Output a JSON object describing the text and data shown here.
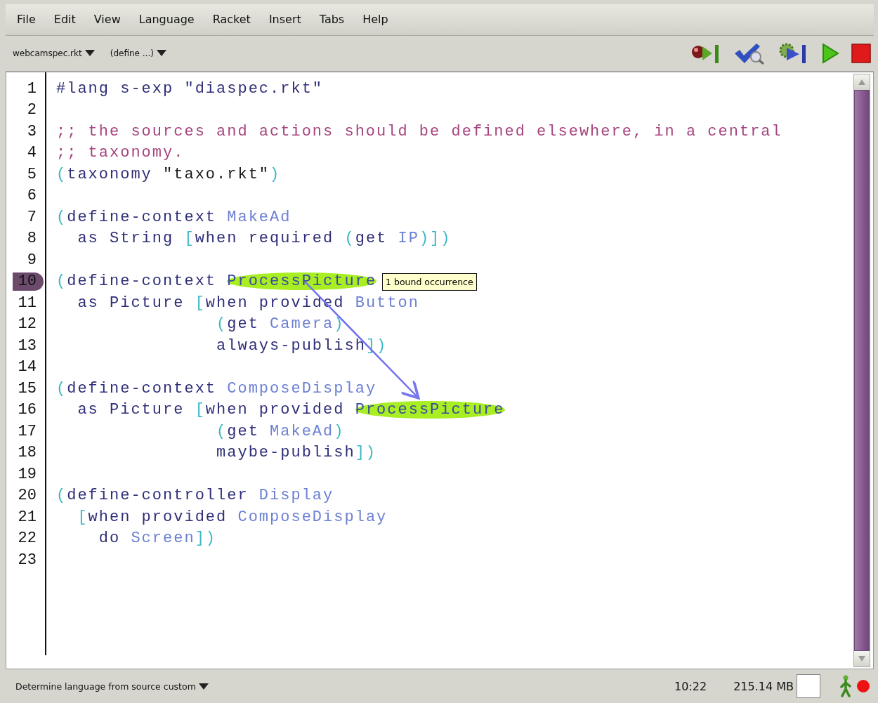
{
  "menu": [
    "File",
    "Edit",
    "View",
    "Language",
    "Racket",
    "Insert",
    "Tabs",
    "Help"
  ],
  "toolbar": {
    "file_menu": "webcamspec.rkt",
    "define_menu": "(define ...)"
  },
  "editor": {
    "lines": [
      {
        "number": "1",
        "marked": false,
        "tokens": [
          {
            "text": "#lang s-exp \"diaspec.rkt\"",
            "kind": "plain",
            "highlighted": false
          }
        ]
      },
      {
        "number": "2",
        "marked": false
      },
      {
        "number": "3",
        "marked": false,
        "tokens": [
          {
            "text": ";; the sources and actions should be defined elsewhere, in a central",
            "kind": "comment",
            "highlighted": false
          }
        ]
      },
      {
        "number": "4",
        "marked": false,
        "tokens": [
          {
            "text": ";; taxonomy.",
            "kind": "comment",
            "highlighted": false
          }
        ]
      },
      {
        "number": "5",
        "marked": false,
        "tokens": [
          {
            "text": "(",
            "kind": "paren",
            "highlighted": false
          },
          {
            "text": "taxonomy ",
            "kind": "plain",
            "highlighted": false
          },
          {
            "text": "\"taxo.rkt\"",
            "kind": "string",
            "highlighted": false
          },
          {
            "text": ")",
            "kind": "paren",
            "highlighted": false
          }
        ]
      },
      {
        "number": "6",
        "marked": false
      },
      {
        "number": "7",
        "marked": false,
        "tokens": [
          {
            "text": "(",
            "kind": "paren",
            "highlighted": false
          },
          {
            "text": "define-context ",
            "kind": "plain",
            "highlighted": false
          },
          {
            "text": "MakeAd",
            "kind": "ident",
            "highlighted": false
          }
        ]
      },
      {
        "number": "8",
        "marked": false,
        "tokens": [
          {
            "text": "  as String ",
            "kind": "plain",
            "highlighted": false
          },
          {
            "text": "[",
            "kind": "paren",
            "highlighted": false
          },
          {
            "text": "when required ",
            "kind": "plain",
            "highlighted": false
          },
          {
            "text": "(",
            "kind": "paren",
            "highlighted": false
          },
          {
            "text": "get ",
            "kind": "plain",
            "highlighted": false
          },
          {
            "text": "IP",
            "kind": "ident",
            "highlighted": false
          },
          {
            "text": ")])",
            "kind": "paren",
            "highlighted": false
          }
        ]
      },
      {
        "number": "9",
        "marked": false
      },
      {
        "number": "10",
        "marked": true,
        "tokens": [
          {
            "text": "(",
            "kind": "paren",
            "highlighted": false
          },
          {
            "text": "define-context ",
            "kind": "plain",
            "highlighted": false
          },
          {
            "text": "ProcessPicture",
            "kind": "ident",
            "highlighted": true
          }
        ],
        "tooltip": "1 bound occurrence"
      },
      {
        "number": "11",
        "marked": false,
        "tokens": [
          {
            "text": "  as Picture ",
            "kind": "plain",
            "highlighted": false
          },
          {
            "text": "[",
            "kind": "paren",
            "highlighted": false
          },
          {
            "text": "when provided ",
            "kind": "plain",
            "highlighted": false
          },
          {
            "text": "Button",
            "kind": "ident",
            "highlighted": false
          }
        ]
      },
      {
        "number": "12",
        "marked": false,
        "tokens": [
          {
            "text": "               (",
            "kind": "paren",
            "highlighted": false
          },
          {
            "text": "get ",
            "kind": "plain",
            "highlighted": false
          },
          {
            "text": "Camera",
            "kind": "ident",
            "highlighted": false
          },
          {
            "text": ")",
            "kind": "paren",
            "highlighted": false
          }
        ]
      },
      {
        "number": "13",
        "marked": false,
        "tokens": [
          {
            "text": "               always-publish",
            "kind": "plain",
            "highlighted": false
          },
          {
            "text": "])",
            "kind": "paren",
            "highlighted": false
          }
        ]
      },
      {
        "number": "14",
        "marked": false
      },
      {
        "number": "15",
        "marked": false,
        "tokens": [
          {
            "text": "(",
            "kind": "paren",
            "highlighted": false
          },
          {
            "text": "define-context ",
            "kind": "plain",
            "highlighted": false
          },
          {
            "text": "ComposeDisplay",
            "kind": "ident",
            "highlighted": false
          }
        ]
      },
      {
        "number": "16",
        "marked": false,
        "tokens": [
          {
            "text": "  as Picture ",
            "kind": "plain",
            "highlighted": false
          },
          {
            "text": "[",
            "kind": "paren",
            "highlighted": false
          },
          {
            "text": "when provided ",
            "kind": "plain",
            "highlighted": false
          },
          {
            "text": "ProcessPicture",
            "kind": "ident",
            "highlighted": true
          }
        ]
      },
      {
        "number": "17",
        "marked": false,
        "tokens": [
          {
            "text": "               (",
            "kind": "paren",
            "highlighted": false
          },
          {
            "text": "get ",
            "kind": "plain",
            "highlighted": false
          },
          {
            "text": "MakeAd",
            "kind": "ident",
            "highlighted": false
          },
          {
            "text": ")",
            "kind": "paren",
            "highlighted": false
          }
        ]
      },
      {
        "number": "18",
        "marked": false,
        "tokens": [
          {
            "text": "               maybe-publish",
            "kind": "plain",
            "highlighted": false
          },
          {
            "text": "])",
            "kind": "paren",
            "highlighted": false
          }
        ]
      },
      {
        "number": "19",
        "marked": false
      },
      {
        "number": "20",
        "marked": false,
        "tokens": [
          {
            "text": "(",
            "kind": "paren",
            "highlighted": false
          },
          {
            "text": "define-controller ",
            "kind": "plain",
            "highlighted": false
          },
          {
            "text": "Display",
            "kind": "ident",
            "highlighted": false
          }
        ]
      },
      {
        "number": "21",
        "marked": false,
        "tokens": [
          {
            "text": "  [",
            "kind": "paren",
            "highlighted": false
          },
          {
            "text": "when provided ",
            "kind": "plain",
            "highlighted": false
          },
          {
            "text": "ComposeDisplay",
            "kind": "ident",
            "highlighted": false
          }
        ]
      },
      {
        "number": "22",
        "marked": false,
        "tokens": [
          {
            "text": "    do ",
            "kind": "plain",
            "highlighted": false
          },
          {
            "text": "Screen",
            "kind": "ident",
            "highlighted": false
          },
          {
            "text": "])",
            "kind": "paren",
            "highlighted": false
          }
        ]
      },
      {
        "number": "23",
        "marked": false
      }
    ]
  },
  "status_bar": {
    "language": "Determine language from source custom",
    "position": "10:22",
    "memory": "215.14 MB"
  }
}
